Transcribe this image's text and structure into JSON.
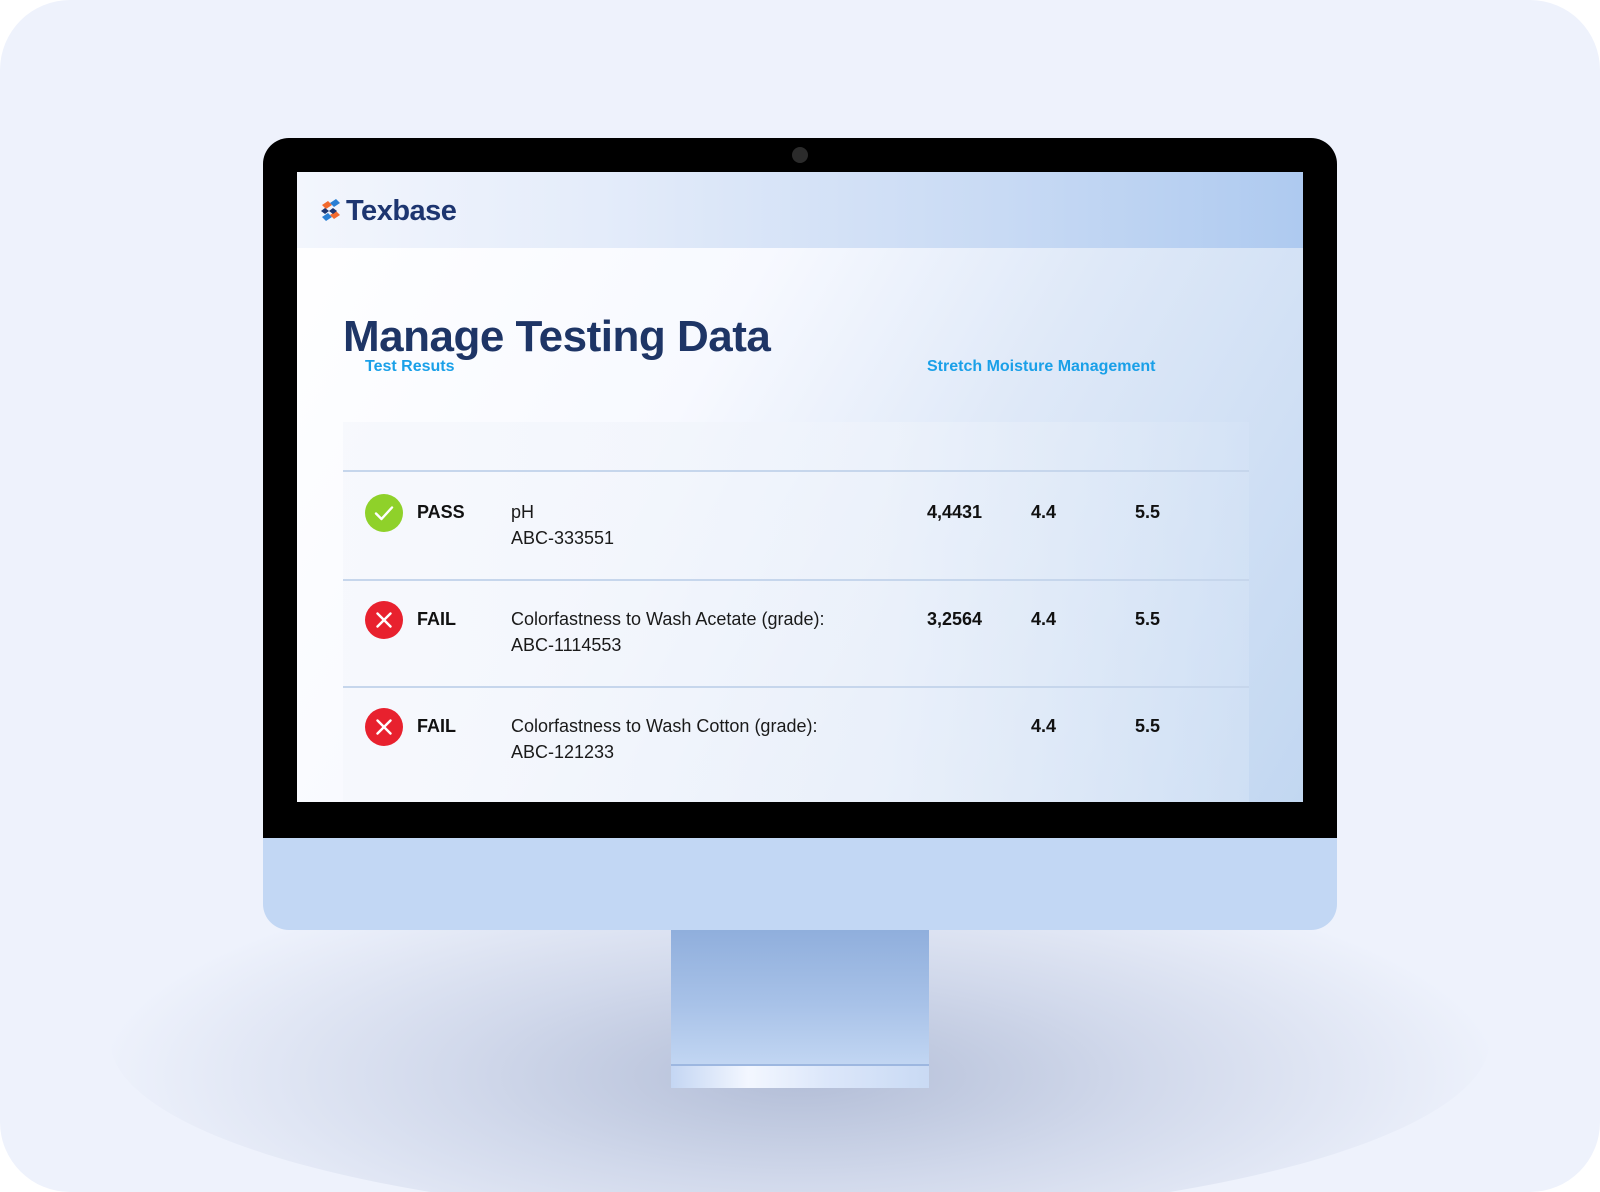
{
  "brand": {
    "name": "Texbase",
    "colors": {
      "navy": "#1d3570",
      "accent_blue": "#1aa0e8",
      "pass_green": "#8fd12a",
      "fail_red": "#e8212e",
      "logo_orange": "#f26a2e",
      "logo_blue": "#2a7fd4"
    }
  },
  "page": {
    "title": "Manage Testing Data"
  },
  "table": {
    "headers": {
      "results": "Test Resuts",
      "stretch": "Stretch Moisture Management"
    },
    "rows": [
      {
        "status": "PASS",
        "status_icon": "check-icon",
        "name": "pH",
        "code": "ABC-333551",
        "value": "4,4431",
        "min": "4.4",
        "max": "5.5"
      },
      {
        "status": "FAIL",
        "status_icon": "close-icon",
        "name": "Colorfastness to Wash Acetate (grade):",
        "code": "ABC-1114553",
        "value": "3,2564",
        "min": "4.4",
        "max": "5.5"
      },
      {
        "status": "FAIL",
        "status_icon": "close-icon",
        "name": "Colorfastness to Wash Cotton (grade):",
        "code": "ABC-121233",
        "value": "",
        "min": "4.4",
        "max": "5.5"
      }
    ]
  }
}
